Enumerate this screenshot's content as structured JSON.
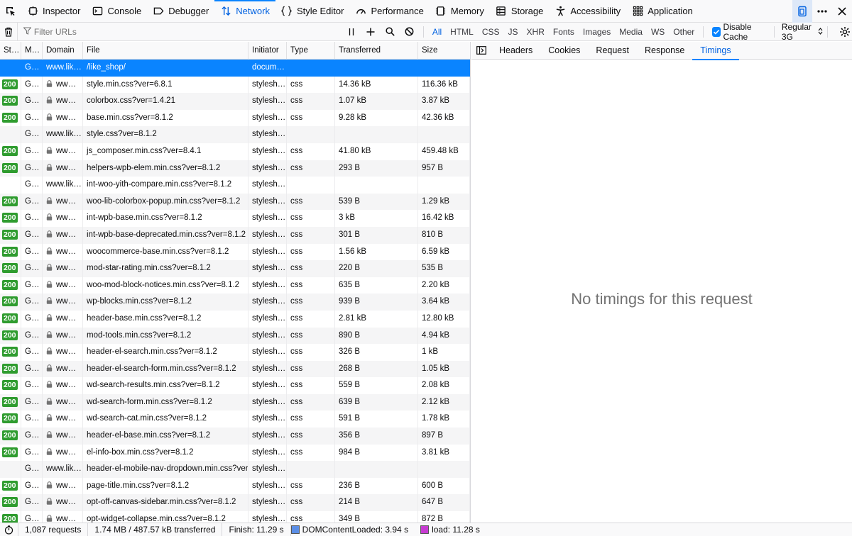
{
  "toolbox": {
    "tabs": [
      {
        "label": "Inspector",
        "icon": "inspector-icon"
      },
      {
        "label": "Console",
        "icon": "console-icon"
      },
      {
        "label": "Debugger",
        "icon": "debugger-icon"
      },
      {
        "label": "Network",
        "icon": "network-icon",
        "active": true
      },
      {
        "label": "Style Editor",
        "icon": "style-editor-icon"
      },
      {
        "label": "Performance",
        "icon": "performance-icon"
      },
      {
        "label": "Memory",
        "icon": "memory-icon"
      },
      {
        "label": "Storage",
        "icon": "storage-icon"
      },
      {
        "label": "Accessibility",
        "icon": "accessibility-icon"
      },
      {
        "label": "Application",
        "icon": "application-icon"
      }
    ]
  },
  "filter": {
    "placeholder": "Filter URLs",
    "types": [
      "All",
      "HTML",
      "CSS",
      "JS",
      "XHR",
      "Fonts",
      "Images",
      "Media",
      "WS",
      "Other"
    ],
    "active_type": "All",
    "disable_cache_label": "Disable Cache",
    "throttle": "Regular 3G"
  },
  "columns": {
    "status": "St…",
    "method": "M…",
    "domain": "Domain",
    "file": "File",
    "initiator": "Initiator",
    "type": "Type",
    "transferred": "Transferred",
    "size": "Size"
  },
  "requests": [
    {
      "status": "",
      "method": "G…",
      "domain": "www.lik…",
      "secure": false,
      "file": "/like_shop/",
      "initiator": "docum…",
      "type": "",
      "transferred": "",
      "size": "",
      "selected": true
    },
    {
      "status": "200",
      "method": "G…",
      "domain": "ww…",
      "secure": true,
      "file": "style.min.css?ver=6.8.1",
      "initiator": "stylesh…",
      "type": "css",
      "transferred": "14.36 kB",
      "size": "116.36 kB"
    },
    {
      "status": "200",
      "method": "G…",
      "domain": "ww…",
      "secure": true,
      "file": "colorbox.css?ver=1.4.21",
      "initiator": "stylesh…",
      "type": "css",
      "transferred": "1.07 kB",
      "size": "3.87 kB"
    },
    {
      "status": "200",
      "method": "G…",
      "domain": "ww…",
      "secure": true,
      "file": "base.min.css?ver=8.1.2",
      "initiator": "stylesh…",
      "type": "css",
      "transferred": "9.28 kB",
      "size": "42.36 kB"
    },
    {
      "status": "",
      "method": "G…",
      "domain": "www.lik…",
      "secure": false,
      "file": "style.css?ver=8.1.2",
      "initiator": "stylesh…",
      "type": "",
      "transferred": "",
      "size": ""
    },
    {
      "status": "200",
      "method": "G…",
      "domain": "ww…",
      "secure": true,
      "file": "js_composer.min.css?ver=8.4.1",
      "initiator": "stylesh…",
      "type": "css",
      "transferred": "41.80 kB",
      "size": "459.48 kB"
    },
    {
      "status": "200",
      "method": "G…",
      "domain": "ww…",
      "secure": true,
      "file": "helpers-wpb-elem.min.css?ver=8.1.2",
      "initiator": "stylesh…",
      "type": "css",
      "transferred": "293 B",
      "size": "957 B"
    },
    {
      "status": "",
      "method": "G…",
      "domain": "www.lik…",
      "secure": false,
      "file": "int-woo-yith-compare.min.css?ver=8.1.2",
      "initiator": "stylesh…",
      "type": "",
      "transferred": "",
      "size": ""
    },
    {
      "status": "200",
      "method": "G…",
      "domain": "ww…",
      "secure": true,
      "file": "woo-lib-colorbox-popup.min.css?ver=8.1.2",
      "initiator": "stylesh…",
      "type": "css",
      "transferred": "539 B",
      "size": "1.29 kB"
    },
    {
      "status": "200",
      "method": "G…",
      "domain": "ww…",
      "secure": true,
      "file": "int-wpb-base.min.css?ver=8.1.2",
      "initiator": "stylesh…",
      "type": "css",
      "transferred": "3 kB",
      "size": "16.42 kB"
    },
    {
      "status": "200",
      "method": "G…",
      "domain": "ww…",
      "secure": true,
      "file": "int-wpb-base-deprecated.min.css?ver=8.1.2",
      "initiator": "stylesh…",
      "type": "css",
      "transferred": "301 B",
      "size": "810 B"
    },
    {
      "status": "200",
      "method": "G…",
      "domain": "ww…",
      "secure": true,
      "file": "woocommerce-base.min.css?ver=8.1.2",
      "initiator": "stylesh…",
      "type": "css",
      "transferred": "1.56 kB",
      "size": "6.59 kB"
    },
    {
      "status": "200",
      "method": "G…",
      "domain": "ww…",
      "secure": true,
      "file": "mod-star-rating.min.css?ver=8.1.2",
      "initiator": "stylesh…",
      "type": "css",
      "transferred": "220 B",
      "size": "535 B"
    },
    {
      "status": "200",
      "method": "G…",
      "domain": "ww…",
      "secure": true,
      "file": "woo-mod-block-notices.min.css?ver=8.1.2",
      "initiator": "stylesh…",
      "type": "css",
      "transferred": "635 B",
      "size": "2.20 kB"
    },
    {
      "status": "200",
      "method": "G…",
      "domain": "ww…",
      "secure": true,
      "file": "wp-blocks.min.css?ver=8.1.2",
      "initiator": "stylesh…",
      "type": "css",
      "transferred": "939 B",
      "size": "3.64 kB"
    },
    {
      "status": "200",
      "method": "G…",
      "domain": "ww…",
      "secure": true,
      "file": "header-base.min.css?ver=8.1.2",
      "initiator": "stylesh…",
      "type": "css",
      "transferred": "2.81 kB",
      "size": "12.80 kB"
    },
    {
      "status": "200",
      "method": "G…",
      "domain": "ww…",
      "secure": true,
      "file": "mod-tools.min.css?ver=8.1.2",
      "initiator": "stylesh…",
      "type": "css",
      "transferred": "890 B",
      "size": "4.94 kB"
    },
    {
      "status": "200",
      "method": "G…",
      "domain": "ww…",
      "secure": true,
      "file": "header-el-search.min.css?ver=8.1.2",
      "initiator": "stylesh…",
      "type": "css",
      "transferred": "326 B",
      "size": "1 kB"
    },
    {
      "status": "200",
      "method": "G…",
      "domain": "ww…",
      "secure": true,
      "file": "header-el-search-form.min.css?ver=8.1.2",
      "initiator": "stylesh…",
      "type": "css",
      "transferred": "268 B",
      "size": "1.05 kB"
    },
    {
      "status": "200",
      "method": "G…",
      "domain": "ww…",
      "secure": true,
      "file": "wd-search-results.min.css?ver=8.1.2",
      "initiator": "stylesh…",
      "type": "css",
      "transferred": "559 B",
      "size": "2.08 kB"
    },
    {
      "status": "200",
      "method": "G…",
      "domain": "ww…",
      "secure": true,
      "file": "wd-search-form.min.css?ver=8.1.2",
      "initiator": "stylesh…",
      "type": "css",
      "transferred": "639 B",
      "size": "2.12 kB"
    },
    {
      "status": "200",
      "method": "G…",
      "domain": "ww…",
      "secure": true,
      "file": "wd-search-cat.min.css?ver=8.1.2",
      "initiator": "stylesh…",
      "type": "css",
      "transferred": "591 B",
      "size": "1.78 kB"
    },
    {
      "status": "200",
      "method": "G…",
      "domain": "ww…",
      "secure": true,
      "file": "header-el-base.min.css?ver=8.1.2",
      "initiator": "stylesh…",
      "type": "css",
      "transferred": "356 B",
      "size": "897 B"
    },
    {
      "status": "200",
      "method": "G…",
      "domain": "ww…",
      "secure": true,
      "file": "el-info-box.min.css?ver=8.1.2",
      "initiator": "stylesh…",
      "type": "css",
      "transferred": "984 B",
      "size": "3.81 kB"
    },
    {
      "status": "",
      "method": "G…",
      "domain": "www.lik…",
      "secure": false,
      "file": "header-el-mobile-nav-dropdown.min.css?ver=8.1.2",
      "initiator": "stylesh…",
      "type": "",
      "transferred": "",
      "size": ""
    },
    {
      "status": "200",
      "method": "G…",
      "domain": "ww…",
      "secure": true,
      "file": "page-title.min.css?ver=8.1.2",
      "initiator": "stylesh…",
      "type": "css",
      "transferred": "236 B",
      "size": "600 B"
    },
    {
      "status": "200",
      "method": "G…",
      "domain": "ww…",
      "secure": true,
      "file": "opt-off-canvas-sidebar.min.css?ver=8.1.2",
      "initiator": "stylesh…",
      "type": "css",
      "transferred": "214 B",
      "size": "647 B"
    },
    {
      "status": "200",
      "method": "G…",
      "domain": "ww…",
      "secure": true,
      "file": "opt-widget-collapse.min.css?ver=8.1.2",
      "initiator": "stylesh…",
      "type": "css",
      "transferred": "349 B",
      "size": "872 B"
    }
  ],
  "details": {
    "tabs": [
      "Headers",
      "Cookies",
      "Request",
      "Response",
      "Timings"
    ],
    "active_tab": "Timings",
    "empty_message": "No timings for this request"
  },
  "status_bar": {
    "requests": "1,087 requests",
    "transferred": "1.74 MB / 487.57 kB transferred",
    "finish": "Finish: 11.29 s",
    "dom_content_loaded": "DOMContentLoaded: 3.94 s",
    "load": "load: 11.28 s"
  },
  "colors": {
    "accent": "#0a84ff",
    "status_ok": "#2f9c2f",
    "dcl_marker": "#5b8ee6",
    "load_marker": "#c63bd1"
  }
}
